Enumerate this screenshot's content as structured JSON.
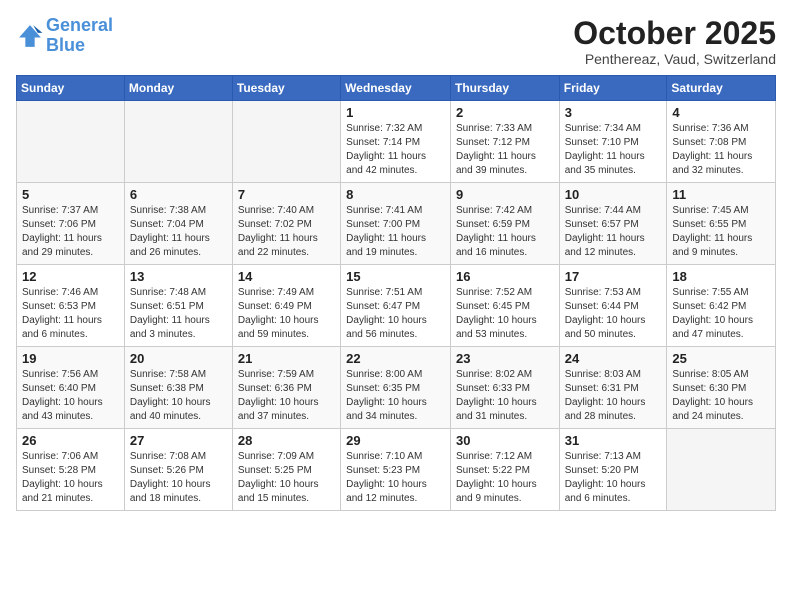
{
  "header": {
    "logo_line1": "General",
    "logo_line2": "Blue",
    "month": "October 2025",
    "location": "Penthereaz, Vaud, Switzerland"
  },
  "weekdays": [
    "Sunday",
    "Monday",
    "Tuesday",
    "Wednesday",
    "Thursday",
    "Friday",
    "Saturday"
  ],
  "weeks": [
    [
      {
        "day": "",
        "info": ""
      },
      {
        "day": "",
        "info": ""
      },
      {
        "day": "",
        "info": ""
      },
      {
        "day": "1",
        "info": "Sunrise: 7:32 AM\nSunset: 7:14 PM\nDaylight: 11 hours\nand 42 minutes."
      },
      {
        "day": "2",
        "info": "Sunrise: 7:33 AM\nSunset: 7:12 PM\nDaylight: 11 hours\nand 39 minutes."
      },
      {
        "day": "3",
        "info": "Sunrise: 7:34 AM\nSunset: 7:10 PM\nDaylight: 11 hours\nand 35 minutes."
      },
      {
        "day": "4",
        "info": "Sunrise: 7:36 AM\nSunset: 7:08 PM\nDaylight: 11 hours\nand 32 minutes."
      }
    ],
    [
      {
        "day": "5",
        "info": "Sunrise: 7:37 AM\nSunset: 7:06 PM\nDaylight: 11 hours\nand 29 minutes."
      },
      {
        "day": "6",
        "info": "Sunrise: 7:38 AM\nSunset: 7:04 PM\nDaylight: 11 hours\nand 26 minutes."
      },
      {
        "day": "7",
        "info": "Sunrise: 7:40 AM\nSunset: 7:02 PM\nDaylight: 11 hours\nand 22 minutes."
      },
      {
        "day": "8",
        "info": "Sunrise: 7:41 AM\nSunset: 7:00 PM\nDaylight: 11 hours\nand 19 minutes."
      },
      {
        "day": "9",
        "info": "Sunrise: 7:42 AM\nSunset: 6:59 PM\nDaylight: 11 hours\nand 16 minutes."
      },
      {
        "day": "10",
        "info": "Sunrise: 7:44 AM\nSunset: 6:57 PM\nDaylight: 11 hours\nand 12 minutes."
      },
      {
        "day": "11",
        "info": "Sunrise: 7:45 AM\nSunset: 6:55 PM\nDaylight: 11 hours\nand 9 minutes."
      }
    ],
    [
      {
        "day": "12",
        "info": "Sunrise: 7:46 AM\nSunset: 6:53 PM\nDaylight: 11 hours\nand 6 minutes."
      },
      {
        "day": "13",
        "info": "Sunrise: 7:48 AM\nSunset: 6:51 PM\nDaylight: 11 hours\nand 3 minutes."
      },
      {
        "day": "14",
        "info": "Sunrise: 7:49 AM\nSunset: 6:49 PM\nDaylight: 10 hours\nand 59 minutes."
      },
      {
        "day": "15",
        "info": "Sunrise: 7:51 AM\nSunset: 6:47 PM\nDaylight: 10 hours\nand 56 minutes."
      },
      {
        "day": "16",
        "info": "Sunrise: 7:52 AM\nSunset: 6:45 PM\nDaylight: 10 hours\nand 53 minutes."
      },
      {
        "day": "17",
        "info": "Sunrise: 7:53 AM\nSunset: 6:44 PM\nDaylight: 10 hours\nand 50 minutes."
      },
      {
        "day": "18",
        "info": "Sunrise: 7:55 AM\nSunset: 6:42 PM\nDaylight: 10 hours\nand 47 minutes."
      }
    ],
    [
      {
        "day": "19",
        "info": "Sunrise: 7:56 AM\nSunset: 6:40 PM\nDaylight: 10 hours\nand 43 minutes."
      },
      {
        "day": "20",
        "info": "Sunrise: 7:58 AM\nSunset: 6:38 PM\nDaylight: 10 hours\nand 40 minutes."
      },
      {
        "day": "21",
        "info": "Sunrise: 7:59 AM\nSunset: 6:36 PM\nDaylight: 10 hours\nand 37 minutes."
      },
      {
        "day": "22",
        "info": "Sunrise: 8:00 AM\nSunset: 6:35 PM\nDaylight: 10 hours\nand 34 minutes."
      },
      {
        "day": "23",
        "info": "Sunrise: 8:02 AM\nSunset: 6:33 PM\nDaylight: 10 hours\nand 31 minutes."
      },
      {
        "day": "24",
        "info": "Sunrise: 8:03 AM\nSunset: 6:31 PM\nDaylight: 10 hours\nand 28 minutes."
      },
      {
        "day": "25",
        "info": "Sunrise: 8:05 AM\nSunset: 6:30 PM\nDaylight: 10 hours\nand 24 minutes."
      }
    ],
    [
      {
        "day": "26",
        "info": "Sunrise: 7:06 AM\nSunset: 5:28 PM\nDaylight: 10 hours\nand 21 minutes."
      },
      {
        "day": "27",
        "info": "Sunrise: 7:08 AM\nSunset: 5:26 PM\nDaylight: 10 hours\nand 18 minutes."
      },
      {
        "day": "28",
        "info": "Sunrise: 7:09 AM\nSunset: 5:25 PM\nDaylight: 10 hours\nand 15 minutes."
      },
      {
        "day": "29",
        "info": "Sunrise: 7:10 AM\nSunset: 5:23 PM\nDaylight: 10 hours\nand 12 minutes."
      },
      {
        "day": "30",
        "info": "Sunrise: 7:12 AM\nSunset: 5:22 PM\nDaylight: 10 hours\nand 9 minutes."
      },
      {
        "day": "31",
        "info": "Sunrise: 7:13 AM\nSunset: 5:20 PM\nDaylight: 10 hours\nand 6 minutes."
      },
      {
        "day": "",
        "info": ""
      }
    ]
  ]
}
